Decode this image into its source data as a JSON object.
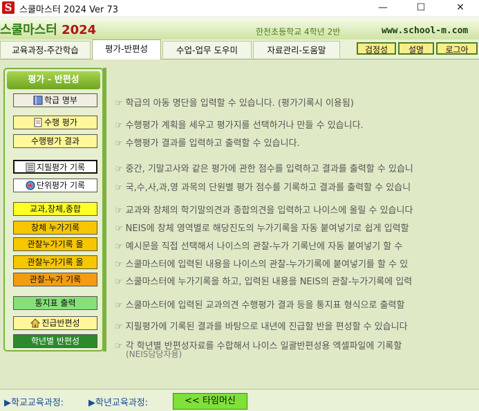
{
  "window": {
    "title": "스쿨마스터 2024   Ver 73",
    "logo_letter": "S",
    "minimize": "—",
    "maximize": "☐",
    "close": "✕"
  },
  "header": {
    "brand": "스쿨마스터",
    "brand_year": "2024",
    "school_info": "한천초등학교 4학년 2반",
    "url": "www.school-m.com"
  },
  "tabs": [
    {
      "label": "교육과정-주간학습"
    },
    {
      "label": "평가-반편성"
    },
    {
      "label": "수업-업무 도우미"
    },
    {
      "label": "자료관리-도움말"
    }
  ],
  "header_buttons": [
    {
      "label": "검정성"
    },
    {
      "label": "설명"
    },
    {
      "label": "로그아"
    }
  ],
  "sidebar": {
    "title": "평가 - 반편성",
    "items": [
      {
        "label": "학급 명부",
        "icon": "book-icon",
        "bg": "#f0eee0"
      },
      {
        "label": "수행 평가",
        "icon": "document-icon",
        "bg": "#fff79a"
      },
      {
        "label": "수행평가 결과",
        "icon": "",
        "bg": "#fff79a"
      },
      {
        "label": "지필평가 기록",
        "icon": "list-icon",
        "bg": "#ffffff"
      },
      {
        "label": "단위평가 기록",
        "icon": "globe-icon",
        "bg": "#ffffff"
      },
      {
        "label": "교과,창체,종합",
        "icon": "",
        "bg": "#ffff26"
      },
      {
        "label": "창체 누가기록",
        "icon": "",
        "bg": "#f6c600"
      },
      {
        "label": "관찰누가기록 올",
        "icon": "",
        "bg": "#f6c600"
      },
      {
        "label": "관찰누가기록 올",
        "icon": "",
        "bg": "#f6c600"
      },
      {
        "label": "관찰-누가 기록",
        "icon": "",
        "bg": "#f39c12"
      },
      {
        "label": "통지표 출력",
        "icon": "",
        "bg": "#85e07a"
      },
      {
        "label": "진급반편성",
        "icon": "house-icon",
        "bg": "#fff79a"
      },
      {
        "label": "학년별 반편성",
        "icon": "",
        "bg": "#2c8a2c"
      }
    ]
  },
  "descriptions": [
    "학급의 아동 명단을 입력할 수 있습니다. (평가기록시 이용됨)",
    "수행평가 계획을 세우고 평가지를 선택하거나 만들 수 있습니다.",
    "수행평가 결과를 입력하고 출력할 수 있습니다.",
    "중간, 기말고사와 같은 평가에 관한 점수를 입력하고 결과를 출력할 수 있습니",
    "국,수,사,과,영 과목의 단원별 평가 점수를 기록하고 결과를 출력할 수 있습니",
    "교과와 창체의 학기말의견과 종합의견을 입력하고 나이스에 올릴 수 있습니다",
    "NEIS에 창체 영역별로 해당진도의 누가기록을 자동 붙여넣기로 쉽게 입력할",
    "예시문을 직접 선택해서 나이스의 관찰-누가 기록난에 자동 붙여넣기 할 수",
    "스쿨마스터에 입력된 내용을 나이스의 관찰-누가기록에 붙여넣기를 할 수 있",
    "스쿨마스터에 누가기록을 하고, 입력된 내용을 NEIS의 관찰-누가기록에 입력",
    "스쿨마스터에 입력된 교과의견 수행평가 결과 등을 통지표 형식으로 출력할",
    "지필평가에 기록된 결과를 바탕으로 내년에 진급할 반을 편성할 수 있습니다",
    "각 학년별 반편성자료를 수합해서 나이스 일괄반편성용 엑셀파일에 기록할"
  ],
  "description_note": "(NEIS담당자용)",
  "description_marker": "☞",
  "bottom": {
    "link1": "▶학교교육과정:",
    "link2": "▶학년교육과정:",
    "time_machine": "<< 타임머신"
  }
}
